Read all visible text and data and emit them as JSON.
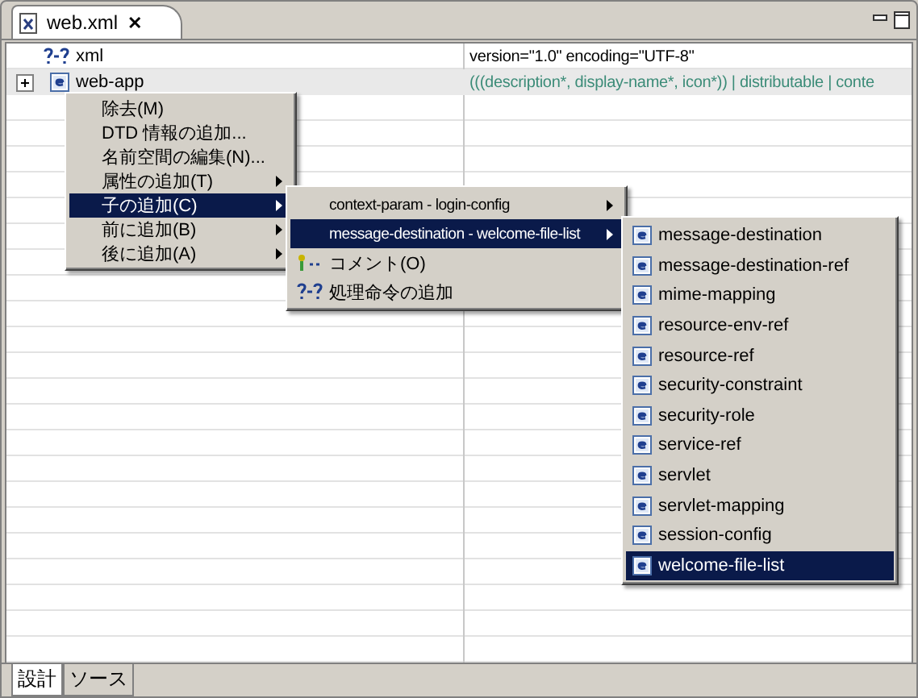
{
  "editor_tab": {
    "title": "web.xml",
    "close": "✕"
  },
  "tree_rows": [
    {
      "kind": "processing",
      "name": "xml",
      "value": "version=\"1.0\" encoding=\"UTF-8\"",
      "expandable": false
    },
    {
      "kind": "element",
      "name": "web-app",
      "value": "(((description*, display-name*, icon*)) | distributable | conte",
      "expandable": true
    }
  ],
  "context_menu": {
    "items": [
      {
        "label": "除去(M)",
        "submenu": false,
        "selected": false
      },
      {
        "label": "DTD 情報の追加...",
        "submenu": false,
        "selected": false
      },
      {
        "label": "名前空間の編集(N)...",
        "submenu": false,
        "selected": false
      },
      {
        "label": "属性の追加(T)",
        "submenu": true,
        "selected": false
      },
      {
        "label": "子の追加(C)",
        "submenu": true,
        "selected": true
      },
      {
        "label": "前に追加(B)",
        "submenu": true,
        "selected": false
      },
      {
        "label": "後に追加(A)",
        "submenu": true,
        "selected": false
      }
    ]
  },
  "child_menu": {
    "items": [
      {
        "label": "context-param - login-config",
        "kind": "group",
        "submenu": true,
        "selected": false
      },
      {
        "label": "message-destination - welcome-file-list",
        "kind": "group",
        "submenu": true,
        "selected": true
      },
      {
        "label": "コメント(O)",
        "kind": "comment",
        "submenu": false,
        "selected": false
      },
      {
        "label": "処理命令の追加",
        "kind": "processing",
        "submenu": false,
        "selected": false
      }
    ]
  },
  "element_menu": {
    "items": [
      {
        "label": "message-destination",
        "selected": false
      },
      {
        "label": "message-destination-ref",
        "selected": false
      },
      {
        "label": "mime-mapping",
        "selected": false
      },
      {
        "label": "resource-env-ref",
        "selected": false
      },
      {
        "label": "resource-ref",
        "selected": false
      },
      {
        "label": "security-constraint",
        "selected": false
      },
      {
        "label": "security-role",
        "selected": false
      },
      {
        "label": "service-ref",
        "selected": false
      },
      {
        "label": "servlet",
        "selected": false
      },
      {
        "label": "servlet-mapping",
        "selected": false
      },
      {
        "label": "session-config",
        "selected": false
      },
      {
        "label": "welcome-file-list",
        "selected": true
      }
    ]
  },
  "bottom_tabs": [
    {
      "label": "設計",
      "selected": true
    },
    {
      "label": "ソース",
      "selected": false
    }
  ]
}
